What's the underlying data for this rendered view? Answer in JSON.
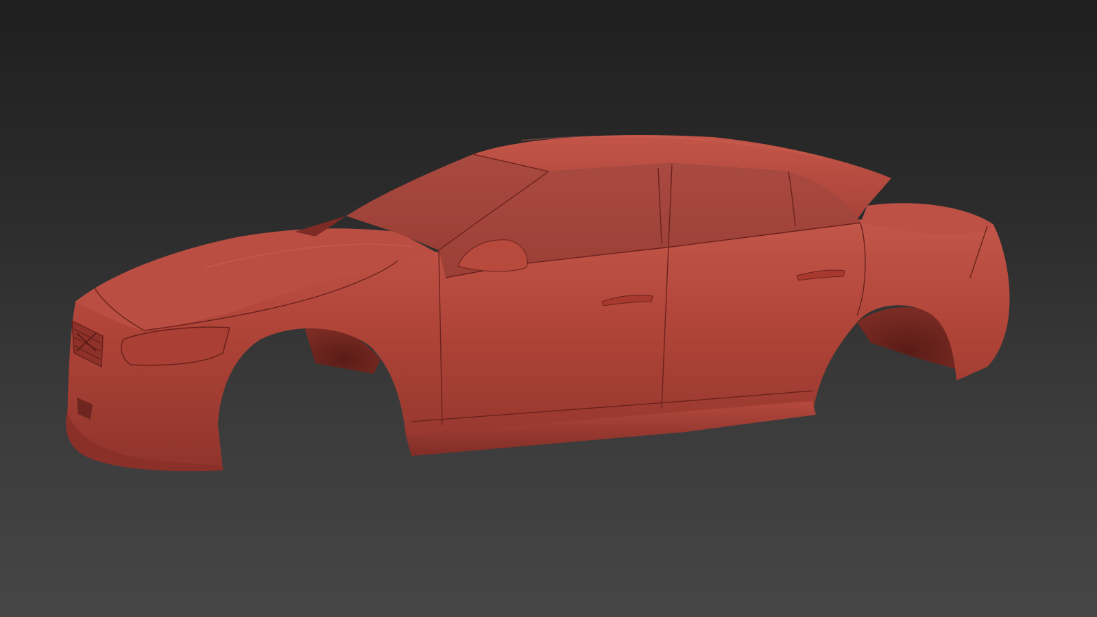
{
  "viewport": {
    "background_top": "#1f1f1f",
    "background_bottom": "#464646"
  },
  "model": {
    "kind": "car-body-shell",
    "color": "#b84a3e",
    "shade_color": "#8e3129",
    "highlight_color": "#c95a4c",
    "line_color": "#6a221c"
  }
}
